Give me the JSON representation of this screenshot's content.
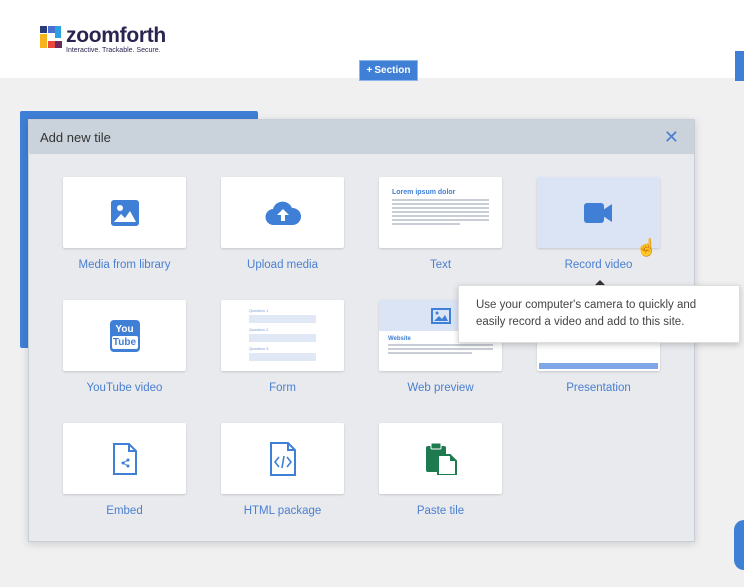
{
  "header": {
    "brand": "zoomforth",
    "tagline": "Interactive. Trackable. Secure.",
    "section_button": "Section"
  },
  "modal": {
    "title": "Add new tile",
    "close_icon": "close-icon",
    "tiles": [
      {
        "label": "Media from library",
        "icon": "image-icon"
      },
      {
        "label": "Upload media",
        "icon": "cloud-upload-icon"
      },
      {
        "label": "Text",
        "icon": "text-preview",
        "preview_heading": "Lorem ipsum dolor"
      },
      {
        "label": "Record video",
        "icon": "video-camera-icon"
      },
      {
        "label": "YouTube video",
        "icon": "youtube-icon",
        "icon_text_top": "You",
        "icon_text_bottom": "Tube"
      },
      {
        "label": "Form",
        "icon": "form-preview",
        "questions": [
          "Question 1",
          "Question 2",
          "Question 3"
        ]
      },
      {
        "label": "Web preview",
        "icon": "web-preview",
        "preview_heading": "Website"
      },
      {
        "label": "Presentation",
        "icon": "presentation-icon"
      },
      {
        "label": "Embed",
        "icon": "embed-file-icon"
      },
      {
        "label": "HTML package",
        "icon": "html-file-icon"
      },
      {
        "label": "Paste tile",
        "icon": "paste-icon"
      }
    ]
  },
  "tooltip": {
    "text": "Use your computer's camera to quickly and easily record a video and add to this site."
  },
  "colors": {
    "accent": "#3f7fd5",
    "modal_header": "#cad3dc",
    "modal_body": "#e8eaee",
    "paste_green": "#1e7a4f"
  }
}
